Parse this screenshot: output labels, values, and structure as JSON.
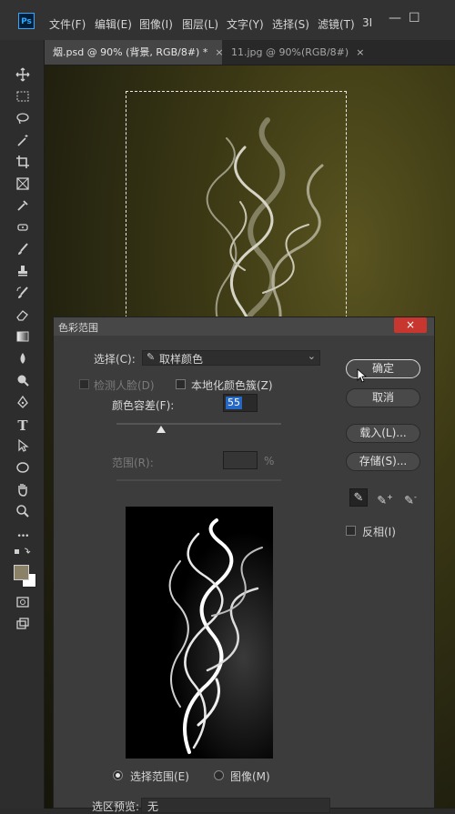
{
  "menubar": {
    "logo": "Ps",
    "items": [
      "文件(F)",
      "编辑(E)",
      "图像(I)",
      "图层(L)",
      "文字(Y)",
      "选择(S)",
      "滤镜(T)",
      "3I"
    ],
    "minimize": "—",
    "restore": "☐"
  },
  "tabs": [
    {
      "label": "烟.psd @ 90% (背景, RGB/8#) *",
      "close": "×"
    },
    {
      "label": "11.jpg @ 90%(RGB/8#)",
      "close": "×"
    }
  ],
  "tools": [
    "move-icon",
    "marquee-icon",
    "lasso-icon",
    "magic-wand-icon",
    "crop-icon",
    "frame-icon",
    "eyedropper-icon",
    "healing-icon",
    "brush-icon",
    "stamp-icon",
    "history-brush-icon",
    "eraser-icon",
    "gradient-icon",
    "blur-icon",
    "dodge-icon",
    "pen-icon",
    "type-icon",
    "path-select-icon",
    "ellipse-icon",
    "hand-icon",
    "zoom-icon",
    "more-icon",
    "swap-colors-icon",
    "color-swatches",
    "quick-mask-icon",
    "screen-mode-icon"
  ],
  "tool_glyphs": {
    "type": "T",
    "more": "•••"
  },
  "colors": {
    "foreground": "#8a8166",
    "background": "#ffffff",
    "accent": "#2767c4",
    "close_button": "#c8372f"
  },
  "dialog": {
    "title": "色彩范围",
    "close": "×",
    "select_label": "选择(C):",
    "select_value": "取样颜色",
    "detect_faces": "检测人脸(D)",
    "localized": "本地化颜色簇(Z)",
    "fuzziness_label": "颜色容差(F):",
    "fuzziness_value": "55",
    "range_label": "范围(R):",
    "range_unit": "%",
    "buttons": {
      "ok": "确定",
      "cancel": "取消",
      "load": "载入(L)...",
      "save": "存储(S)..."
    },
    "invert_label": "反相(I)",
    "radio_selection": "选择范围(E)",
    "radio_image": "图像(M)",
    "preview_label": "选区预览:",
    "preview_value": "无"
  }
}
